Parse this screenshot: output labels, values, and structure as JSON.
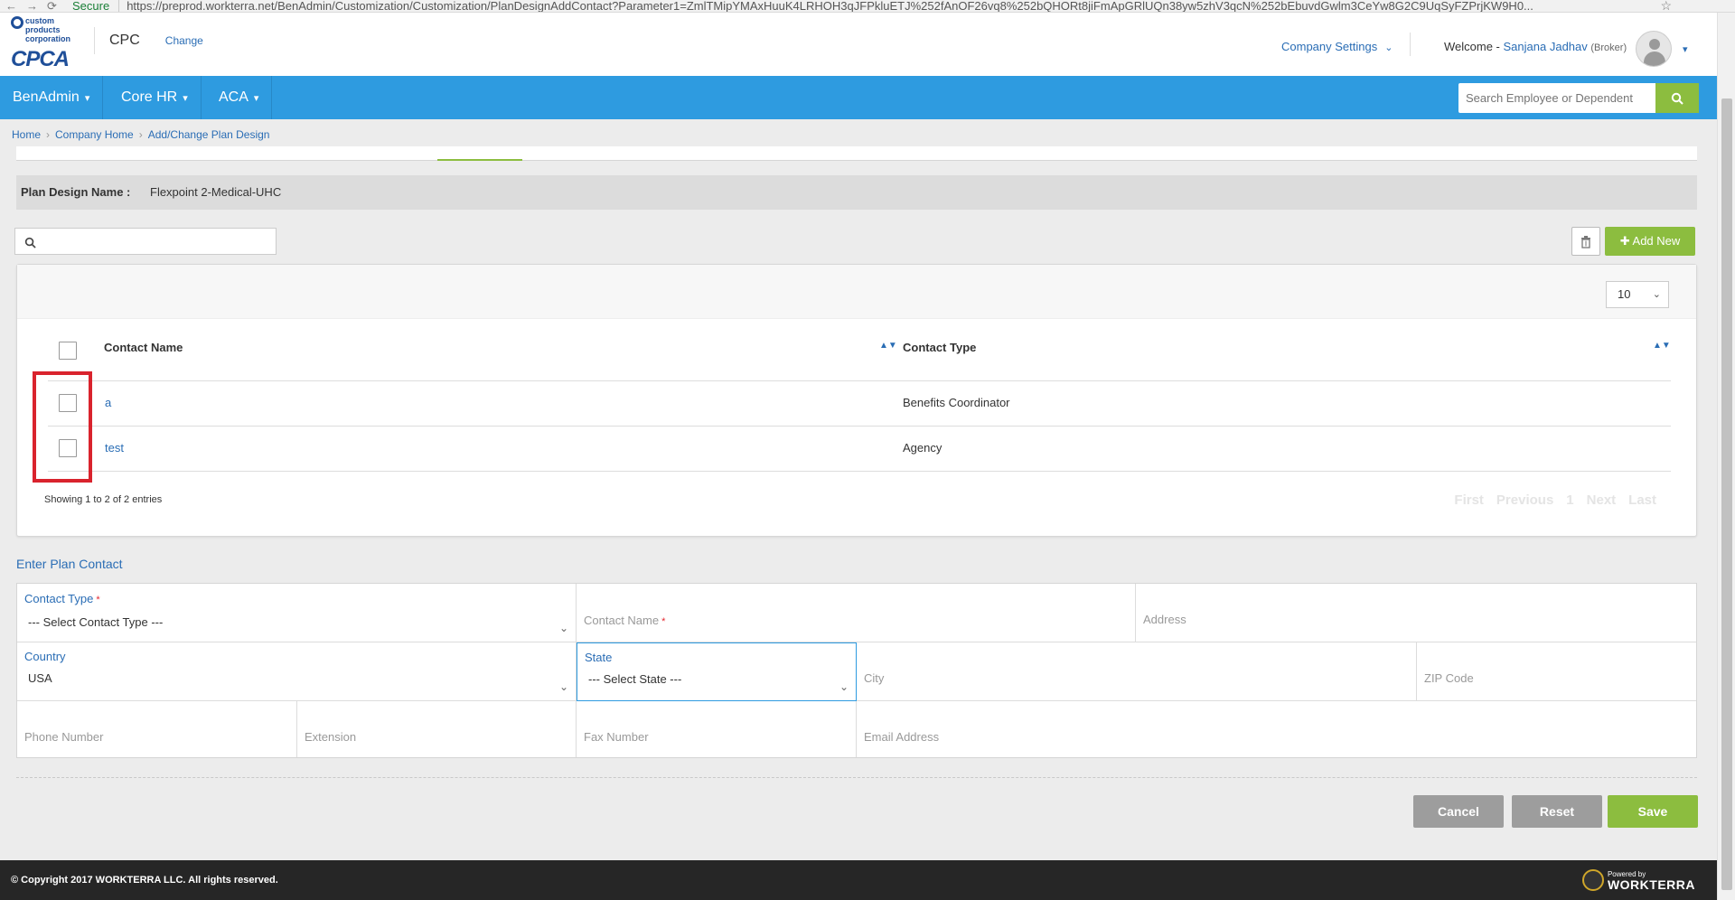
{
  "browser": {
    "secure_label": "Secure",
    "url": "https://preprod.workterra.net/BenAdmin/Customization/Customization/PlanDesignAddContact?Parameter1=ZmlTMipYMAxHuuK4LRHOH3qJFPkluETJ%252fAnOF26vq8%252bQHORt8jiFmApGRlUQn38yw5zhV3qcN%252bEbuvdGwlm3CeYw8G2C9UqSyFZPrjKW9H0..."
  },
  "header": {
    "logo_text_top": "custom products corporation",
    "logo_text": "CPCA",
    "company_code": "CPC",
    "change_link": "Change",
    "company_settings": "Company Settings",
    "welcome_label": "Welcome -",
    "user_name": "Sanjana Jadhav",
    "user_role": "(Broker)"
  },
  "navbar": {
    "items": [
      {
        "label": "BenAdmin"
      },
      {
        "label": "Core HR"
      },
      {
        "label": "ACA"
      }
    ],
    "search_placeholder": "Search Employee or Dependent"
  },
  "breadcrumb": [
    "Home",
    "Company Home",
    "Add/Change Plan Design"
  ],
  "plan_design": {
    "label": "Plan Design Name :",
    "value": "Flexpoint 2-Medical-UHC"
  },
  "toolbar": {
    "add_new": "Add New",
    "page_length": "10"
  },
  "table": {
    "columns": [
      "Contact Name",
      "Contact Type"
    ],
    "rows": [
      {
        "name": "a",
        "type": "Benefits Coordinator"
      },
      {
        "name": "test",
        "type": "Agency"
      }
    ],
    "showing": "Showing 1 to 2 of 2 entries",
    "pager": [
      "First",
      "Previous",
      "1",
      "Next",
      "Last"
    ]
  },
  "form": {
    "title": "Enter Plan Contact",
    "contact_type_label": "Contact Type",
    "contact_type_value": "--- Select Contact Type ---",
    "contact_name_label": "Contact Name",
    "address_label": "Address",
    "country_label": "Country",
    "country_value": "USA",
    "state_label": "State",
    "state_value": "--- Select State ---",
    "city_label": "City",
    "zip_label": "ZIP Code",
    "phone_label": "Phone Number",
    "extension_label": "Extension",
    "fax_label": "Fax Number",
    "email_label": "Email Address",
    "required_mark": "*"
  },
  "buttons": {
    "cancel": "Cancel",
    "reset": "Reset",
    "save": "Save"
  },
  "footer": {
    "copyright": "© Copyright 2017 WORKTERRA LLC. All rights reserved.",
    "powered_by": "Powered by",
    "brand": "WORKTERRA"
  }
}
